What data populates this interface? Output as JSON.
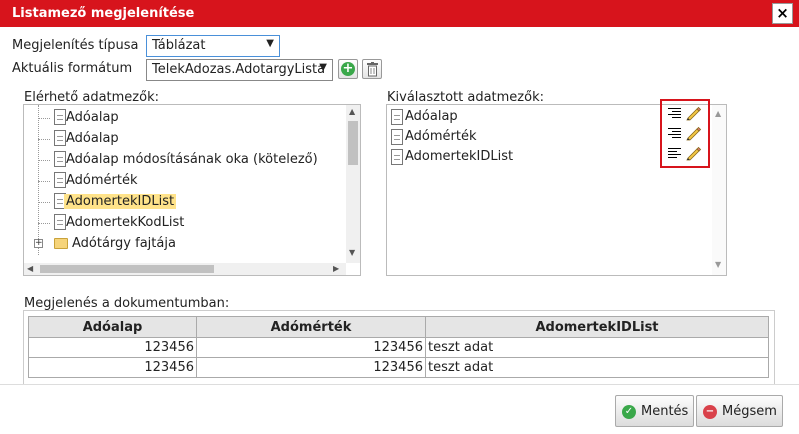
{
  "dialog": {
    "title": "Listamező megjelenítése",
    "close_label": "×"
  },
  "form": {
    "display_type_label": "Megjelenítés típusa",
    "display_type_value": "Táblázat",
    "current_format_label": "Aktuális formátum",
    "current_format_value": "TelekAdozas.AdotargyLista"
  },
  "available": {
    "label": "Elérhető adatmezők:",
    "items": [
      {
        "label": "Adóalap",
        "kind": "field"
      },
      {
        "label": "Adóalap",
        "kind": "field"
      },
      {
        "label": "Adóalap módosításának oka (kötelező)",
        "kind": "field"
      },
      {
        "label": "Adómérték",
        "kind": "field"
      },
      {
        "label": "AdomertekIDList",
        "kind": "field",
        "highlighted": true
      },
      {
        "label": "AdomertekKodList",
        "kind": "field"
      },
      {
        "label": "Adótárgy fajtája",
        "kind": "folder"
      }
    ]
  },
  "selected": {
    "label": "Kiválasztott adatmezők:",
    "items": [
      {
        "label": "Adóalap",
        "align": "right"
      },
      {
        "label": "Adómérték",
        "align": "right"
      },
      {
        "label": "AdomertekIDList",
        "align": "left"
      }
    ]
  },
  "preview": {
    "label": "Megjelenés a dokumentumban:",
    "columns": [
      "Adóalap",
      "Adómérték",
      "AdomertekIDList"
    ],
    "rows": [
      [
        "123456",
        "123456",
        "teszt adat"
      ],
      [
        "123456",
        "123456",
        "teszt adat"
      ]
    ]
  },
  "buttons": {
    "save": "Mentés",
    "cancel": "Mégsem"
  },
  "colors": {
    "titlebar": "#d7141c",
    "highlight": "#ffe38a",
    "save_icon": "#3aa84a",
    "cancel_icon": "#d9414a"
  }
}
